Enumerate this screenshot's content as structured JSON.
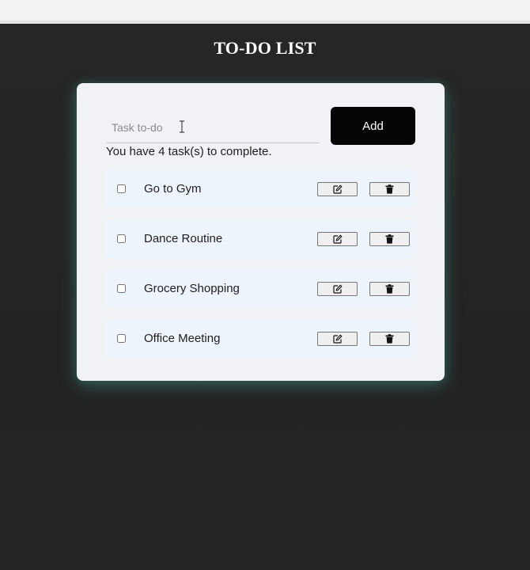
{
  "header": {
    "title": "TO-DO LIST"
  },
  "form": {
    "input_placeholder": "Task to-do",
    "input_value": "",
    "add_label": "Add"
  },
  "status": {
    "count_text": "You have 4 task(s) to complete."
  },
  "tasks": [
    {
      "label": "Go to Gym",
      "completed": false,
      "edit_icon": "pencil-square-icon",
      "delete_icon": "trash-icon"
    },
    {
      "label": "Dance Routine",
      "completed": false,
      "edit_icon": "pencil-square-icon",
      "delete_icon": "trash-icon"
    },
    {
      "label": "Grocery Shopping",
      "completed": false,
      "edit_icon": "pencil-square-icon",
      "delete_icon": "trash-icon"
    },
    {
      "label": "Office Meeting",
      "completed": false,
      "edit_icon": "pencil-square-icon",
      "delete_icon": "trash-icon"
    }
  ],
  "colors": {
    "page_background": "#232323",
    "card_background": "#f1f2f5",
    "task_background": "#eef4fb",
    "add_button": "#050505",
    "card_glow": "#46a096"
  }
}
